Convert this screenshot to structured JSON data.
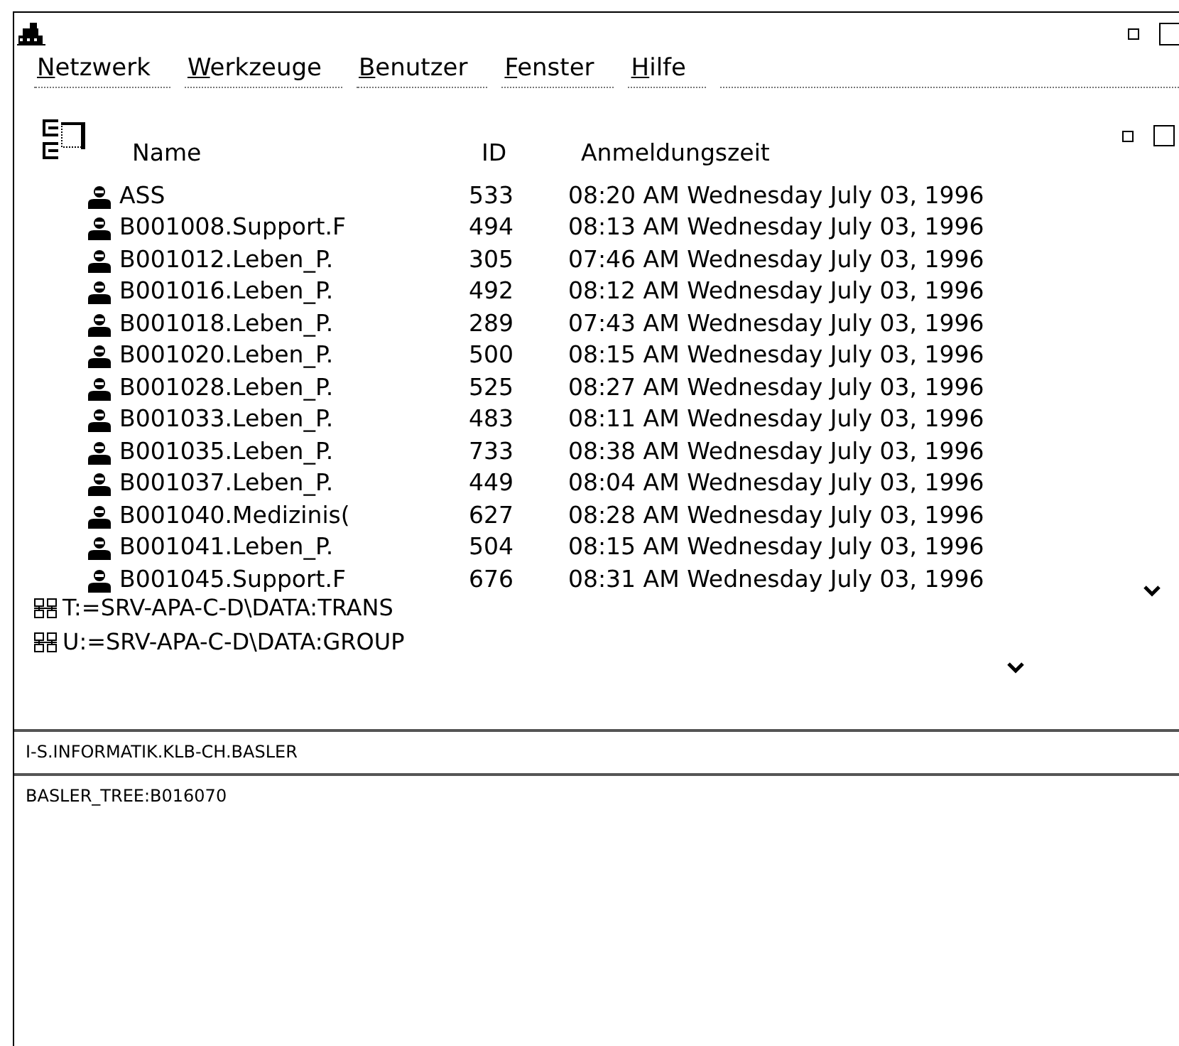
{
  "menu_bar": {
    "items": [
      {
        "label": "Netzwerk"
      },
      {
        "label": "Werkzeuge"
      },
      {
        "label": "Benutzer"
      },
      {
        "label": "Fenster"
      },
      {
        "label": "Hilfe"
      }
    ]
  },
  "user_list": {
    "columns": [
      "Name",
      "ID",
      "Anmeldungszeit"
    ],
    "rows": [
      {
        "name": "ASS",
        "id": "533",
        "login_time": "08:20 AM Wednesday July 03, 1996"
      },
      {
        "name": "B001008.Support.F",
        "id": "494",
        "login_time": "08:13 AM Wednesday July 03, 1996"
      },
      {
        "name": "B001012.Leben_P.",
        "id": "305",
        "login_time": "07:46 AM Wednesday July 03, 1996"
      },
      {
        "name": "B001016.Leben_P.",
        "id": "492",
        "login_time": "08:12 AM Wednesday July 03, 1996"
      },
      {
        "name": "B001018.Leben_P.",
        "id": "289",
        "login_time": "07:43 AM Wednesday July 03, 1996"
      },
      {
        "name": "B001020.Leben_P.",
        "id": "500",
        "login_time": "08:15 AM Wednesday July 03, 1996"
      },
      {
        "name": "B001028.Leben_P.",
        "id": "525",
        "login_time": "08:27 AM Wednesday July 03, 1996"
      },
      {
        "name": "B001033.Leben_P.",
        "id": "483",
        "login_time": "08:11 AM Wednesday July 03, 1996"
      },
      {
        "name": "B001035.Leben_P.",
        "id": "733",
        "login_time": "08:38 AM Wednesday July 03, 1996"
      },
      {
        "name": "B001037.Leben_P.",
        "id": "449",
        "login_time": "08:04 AM Wednesday July 03, 1996"
      },
      {
        "name": "B001040.Medizinis(",
        "id": "627",
        "login_time": "08:28 AM Wednesday July 03, 1996"
      },
      {
        "name": "B001041.Leben_P.",
        "id": "504",
        "login_time": "08:15 AM Wednesday July 03, 1996"
      },
      {
        "name": "B001045.Support.F",
        "id": "676",
        "login_time": "08:31 AM Wednesday July 03, 1996"
      }
    ]
  },
  "drive_mappings": [
    "T:=SRV-APA-C-D\\DATA:TRANS",
    "U:=SRV-APA-C-D\\DATA:GROUP"
  ],
  "status_bar": [
    "I-S.INFORMATIK.KLB-CH.BASLER",
    "BASLER_TREE:B016070"
  ]
}
